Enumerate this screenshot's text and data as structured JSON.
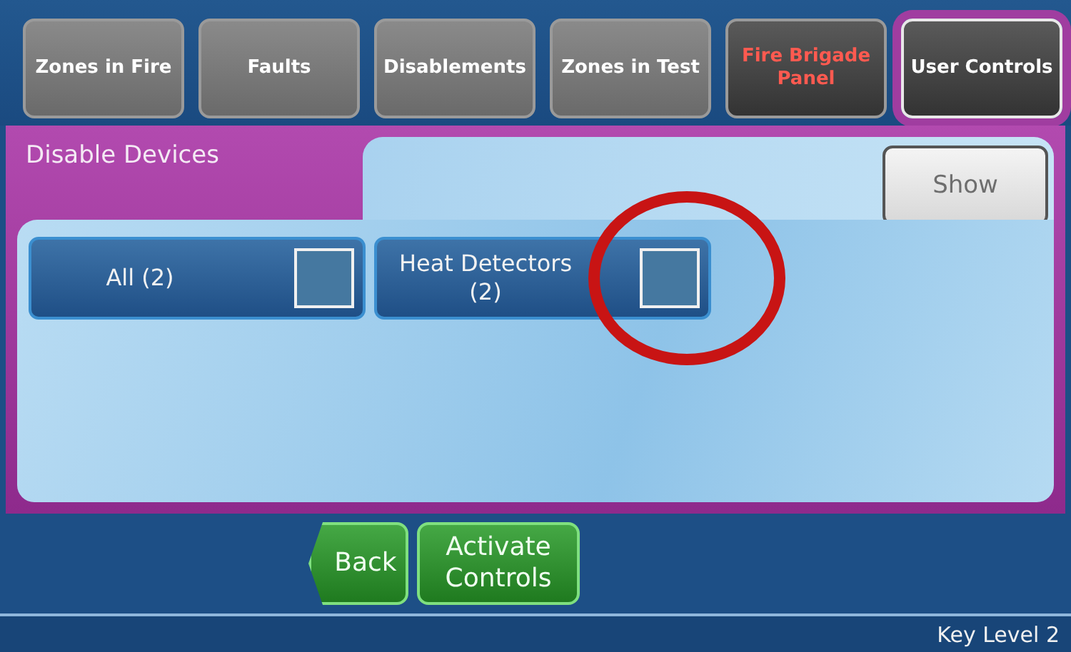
{
  "tabs": [
    {
      "label": "Zones in Fire",
      "kind": "normal",
      "selected": false
    },
    {
      "label": "Faults",
      "kind": "normal",
      "selected": false
    },
    {
      "label": "Disablements",
      "kind": "normal",
      "selected": false
    },
    {
      "label": "Zones in Test",
      "kind": "normal",
      "selected": false
    },
    {
      "label": "Fire Brigade Panel",
      "kind": "alert",
      "selected": false
    },
    {
      "label": "User Controls",
      "kind": "normal",
      "selected": true
    }
  ],
  "panel": {
    "title": "Disable Devices",
    "show_button": {
      "label": "Show",
      "disabled": true
    },
    "devices": [
      {
        "label": "All (2)",
        "checked": false
      },
      {
        "label": "Heat Detectors (2)",
        "checked": false
      }
    ]
  },
  "actions": [
    {
      "label": "Back",
      "kind": "back"
    },
    {
      "label": "Activate Controls",
      "kind": "normal"
    }
  ],
  "status_bar": {
    "text": "Key Level 2"
  }
}
